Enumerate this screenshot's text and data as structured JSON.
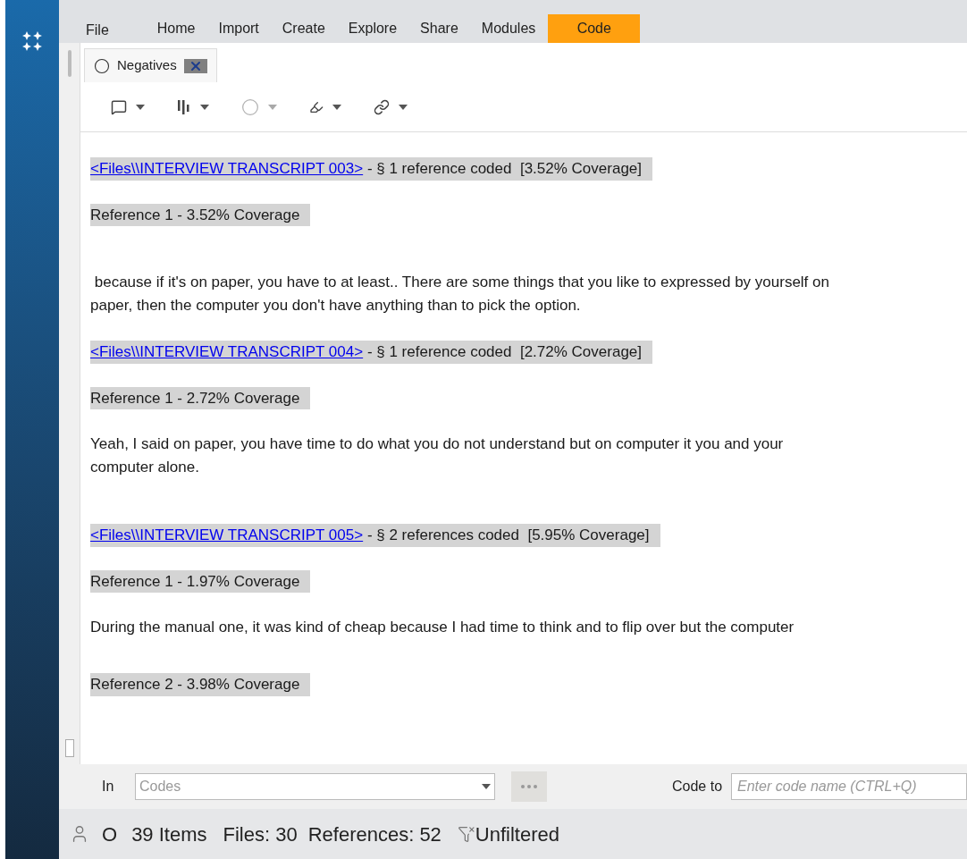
{
  "menu": [
    {
      "label": "File",
      "selected": false
    },
    {
      "label": "Home",
      "selected": false
    },
    {
      "label": "Import",
      "selected": false
    },
    {
      "label": "Create",
      "selected": false
    },
    {
      "label": "Explore",
      "selected": false
    },
    {
      "label": "Share",
      "selected": false
    },
    {
      "label": "Modules",
      "selected": false
    },
    {
      "label": "Code",
      "selected": true
    }
  ],
  "doc_tab": {
    "label": "Negatives",
    "selected": true
  },
  "document": [
    {
      "kind": "source",
      "link": "<Files\\\\INTERVIEW TRANSCRIPT 003>",
      "text": " - § 1 reference coded  [3.52% Coverage]"
    },
    {
      "kind": "reference",
      "text": "Reference 1 - 3.52% Coverage"
    },
    {
      "kind": "paragraph",
      "text": " because if it's on paper, you have to at least.. There are some things that you like to expressed by yourself on paper, then the computer you don't have anything than to pick the option."
    },
    {
      "kind": "source",
      "link": "<Files\\\\INTERVIEW TRANSCRIPT 004>",
      "text": " - § 1 reference coded  [2.72% Coverage]"
    },
    {
      "kind": "reference",
      "text": "Reference 1 - 2.72% Coverage"
    },
    {
      "kind": "paragraph",
      "text": "Yeah, I said on paper, you have time to do what you do not understand but on computer it you and your computer alone."
    },
    {
      "kind": "source",
      "link": "<Files\\\\INTERVIEW TRANSCRIPT 005>",
      "text": " - § 2 references coded  [5.95% Coverage]"
    },
    {
      "kind": "reference",
      "text": "Reference 1 - 1.97% Coverage"
    },
    {
      "kind": "paragraph",
      "text": "During the manual one, it was kind of cheap because I had time to think and to flip over but the computer"
    },
    {
      "kind": "reference",
      "text": "Reference 2 - 3.98% Coverage"
    }
  ],
  "coding_bar": {
    "in_label": "In",
    "in_placeholder": "Codes",
    "code_to_label": "Code to",
    "code_to_placeholder": "Enter code name (CTRL+Q)"
  },
  "status_bar": {
    "initial": "O",
    "items": "39 Items",
    "files": "Files: 30",
    "references": "References: 52",
    "filter": "Unfiltered"
  }
}
